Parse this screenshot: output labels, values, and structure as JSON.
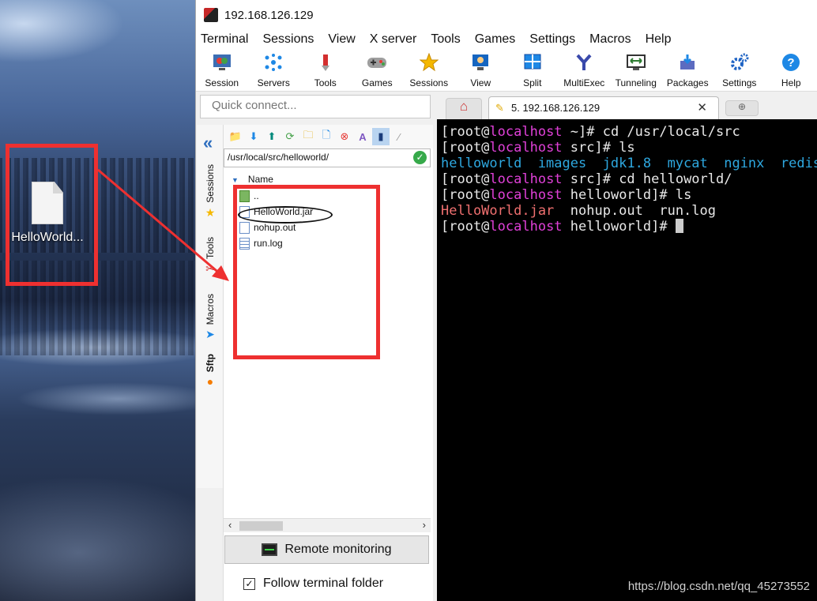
{
  "desktop": {
    "icon_label": "HelloWorld..."
  },
  "window": {
    "title": "192.168.126.129"
  },
  "menu": [
    "Terminal",
    "Sessions",
    "View",
    "X server",
    "Tools",
    "Games",
    "Settings",
    "Macros",
    "Help"
  ],
  "toolbar": [
    {
      "label": "Session",
      "icon": "session-icon"
    },
    {
      "label": "Servers",
      "icon": "servers-icon"
    },
    {
      "label": "Tools",
      "icon": "tools-icon"
    },
    {
      "label": "Games",
      "icon": "games-icon"
    },
    {
      "label": "Sessions",
      "icon": "sessions-star-icon"
    },
    {
      "label": "View",
      "icon": "view-icon"
    },
    {
      "label": "Split",
      "icon": "split-icon"
    },
    {
      "label": "MultiExec",
      "icon": "multiexec-icon"
    },
    {
      "label": "Tunneling",
      "icon": "tunneling-icon"
    },
    {
      "label": "Packages",
      "icon": "packages-icon"
    },
    {
      "label": "Settings",
      "icon": "settings-gear-icon"
    },
    {
      "label": "Help",
      "icon": "help-icon"
    }
  ],
  "quick_connect": {
    "placeholder": "Quick connect..."
  },
  "side_tabs": [
    "Sessions",
    "Tools",
    "Macros",
    "Sftp"
  ],
  "sftp": {
    "path": "/usr/local/src/helloworld/",
    "column_name": "Name",
    "files": [
      "..",
      "HelloWorld.jar",
      "nohup.out",
      "run.log"
    ],
    "remote_monitoring": "Remote monitoring",
    "follow_folder": "Follow terminal folder",
    "follow_checked": true
  },
  "tabs": {
    "session_tab": "5. 192.168.126.129"
  },
  "terminal": {
    "lines": [
      {
        "user": "[root@",
        "host": "localhost",
        "rest": " ~]# cd /usr/local/src"
      },
      {
        "user": "[root@",
        "host": "localhost",
        "rest": " src]# ls"
      },
      {
        "dirs": "helloworld  images  jdk1.8  mycat  nginx  redis"
      },
      {
        "user": "[root@",
        "host": "localhost",
        "rest": " src]# cd helloworld/"
      },
      {
        "user": "[root@",
        "host": "localhost",
        "rest": " helloworld]# ls"
      },
      {
        "jar": "HelloWorld.jar",
        "files": "  nohup.out  run.log"
      },
      {
        "user": "[root@",
        "host": "localhost",
        "rest": " helloworld]# "
      }
    ]
  },
  "watermark": "https://blog.csdn.net/qq_45273552",
  "colors": {
    "host": "#e040d8",
    "dir": "#2ea8e0",
    "jar": "#f07070",
    "annotation": "#ee3030"
  }
}
